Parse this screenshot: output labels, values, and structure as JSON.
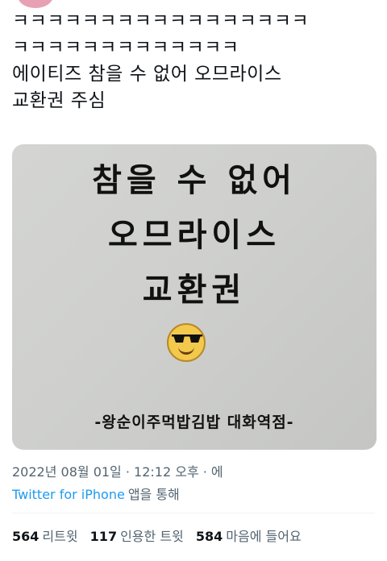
{
  "tweet": {
    "lines": [
      "ㅋㅋㅋㅋㅋㅋㅋㅋㅋㅋㅋㅋㅋㅋㅋㅋㅋ",
      "ㅋㅋㅋㅋㅋㅋㅋㅋㅋㅋㅋㅋㅋ",
      "에이티즈 참을 수 없어 오므라이스",
      "교환권 주심"
    ]
  },
  "media": {
    "line1": "참을 수 없어",
    "line2": "오므라이스",
    "line3": "교환권",
    "emoji": "sunglasses-smiley-icon",
    "footer": "-왕순이주먹밥김밥 대화역점-"
  },
  "meta": {
    "timestamp": "2022년 08월 01일 · 12:12 오후 · 에",
    "source": "Twitter for iPhone",
    "source_suffix": "앱을 통해"
  },
  "stats": {
    "retweets_count": "564",
    "retweets_label": "리트윗",
    "quotes_count": "117",
    "quotes_label": "인용한 트윗",
    "likes_count": "584",
    "likes_label": "마음에 들어요"
  }
}
